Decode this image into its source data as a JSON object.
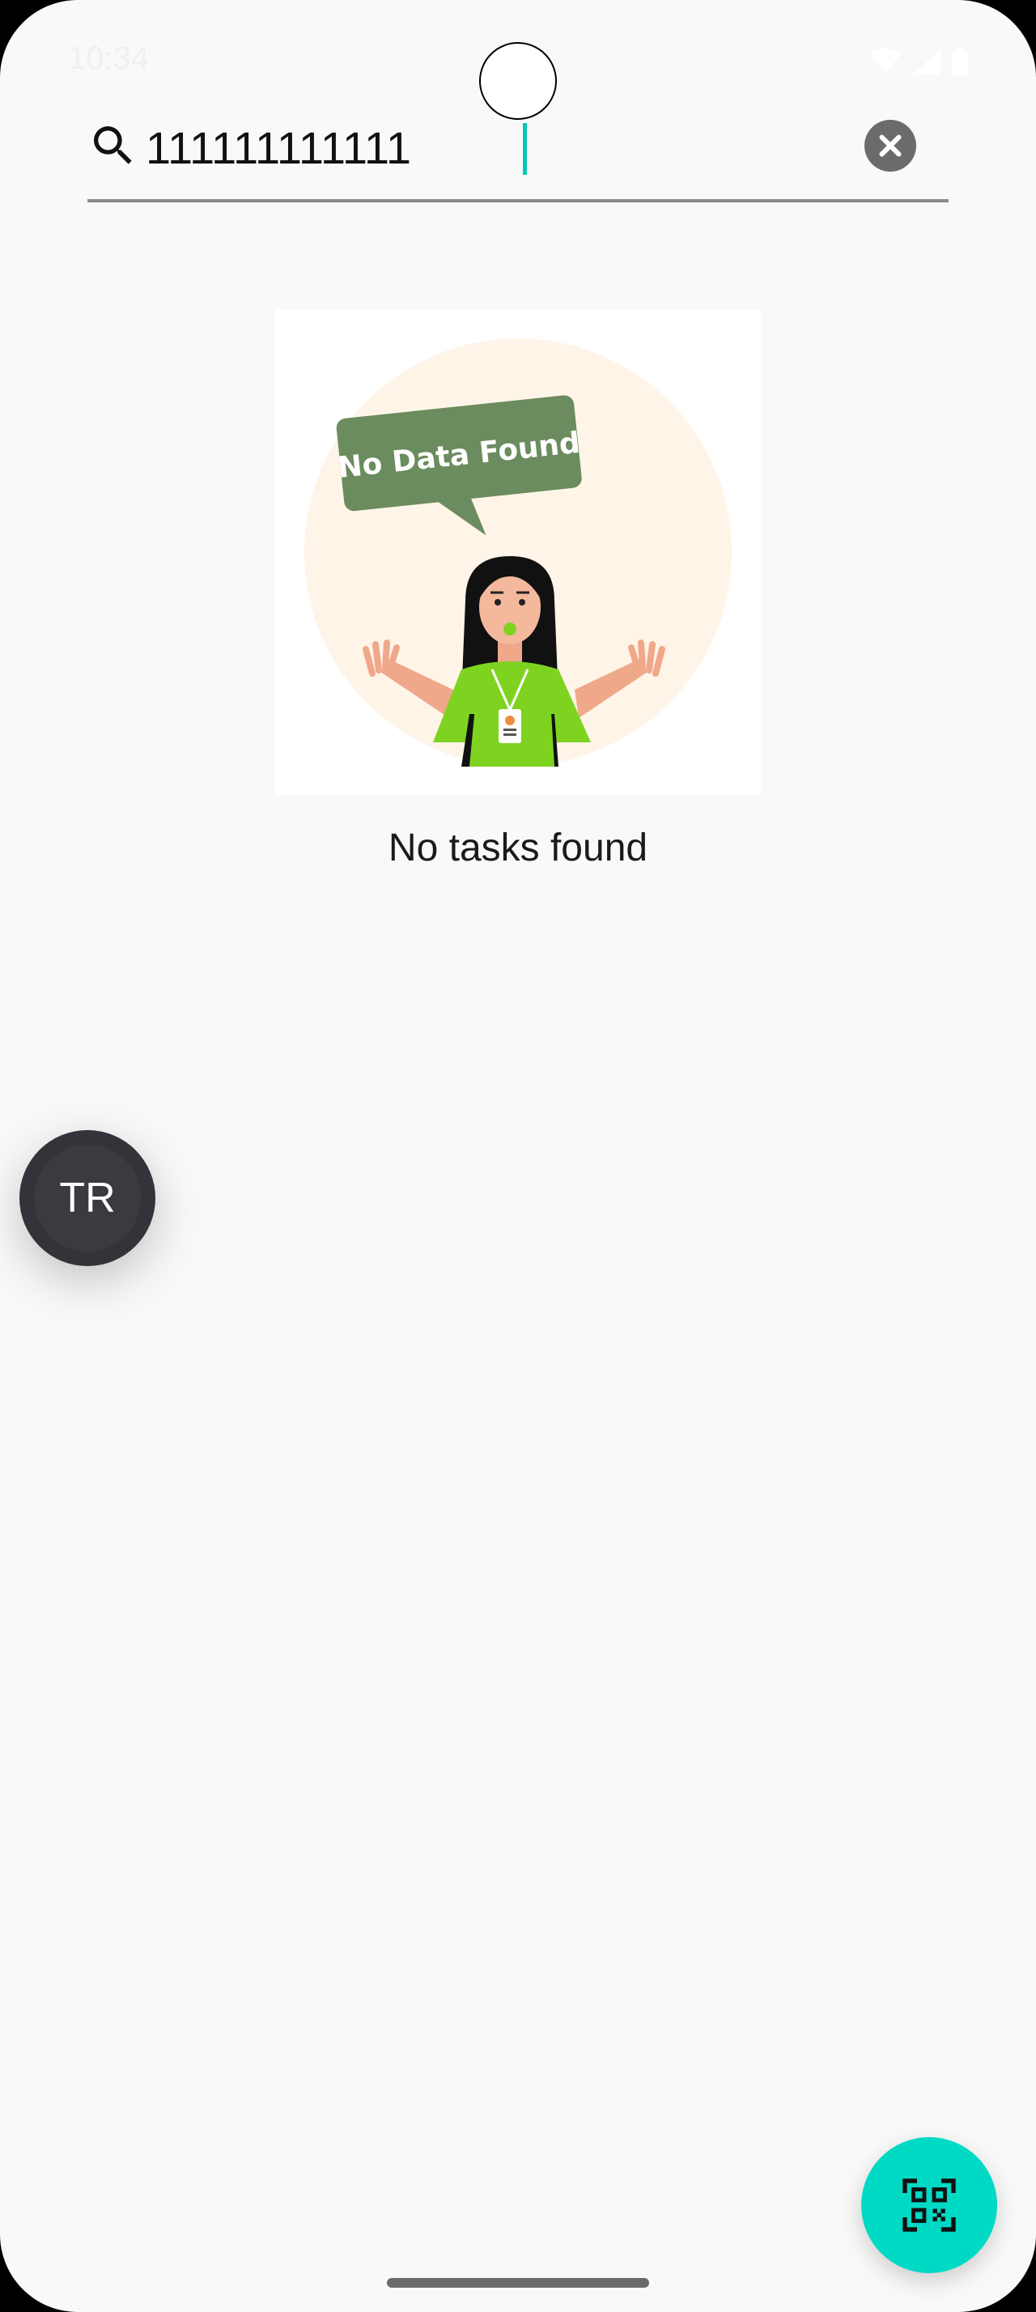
{
  "status_bar": {
    "time": "10:34",
    "icons": [
      "wifi-icon",
      "cellular-signal-icon",
      "battery-icon"
    ]
  },
  "search": {
    "value": "111111111111",
    "icon": "search-icon",
    "clear_icon": "close-icon"
  },
  "empty_state": {
    "illustration_text": "No Data Found",
    "message": "No tasks found"
  },
  "avatar": {
    "initials": "TR"
  },
  "fab": {
    "icon": "qr-scan-icon"
  },
  "colors": {
    "accent": "#00d9c4",
    "caret": "#00c9b7",
    "bubble": "#6b8c5e",
    "shirt": "#7ed321",
    "circle": "#fff4e8",
    "avatar_bg": "#33343a"
  }
}
